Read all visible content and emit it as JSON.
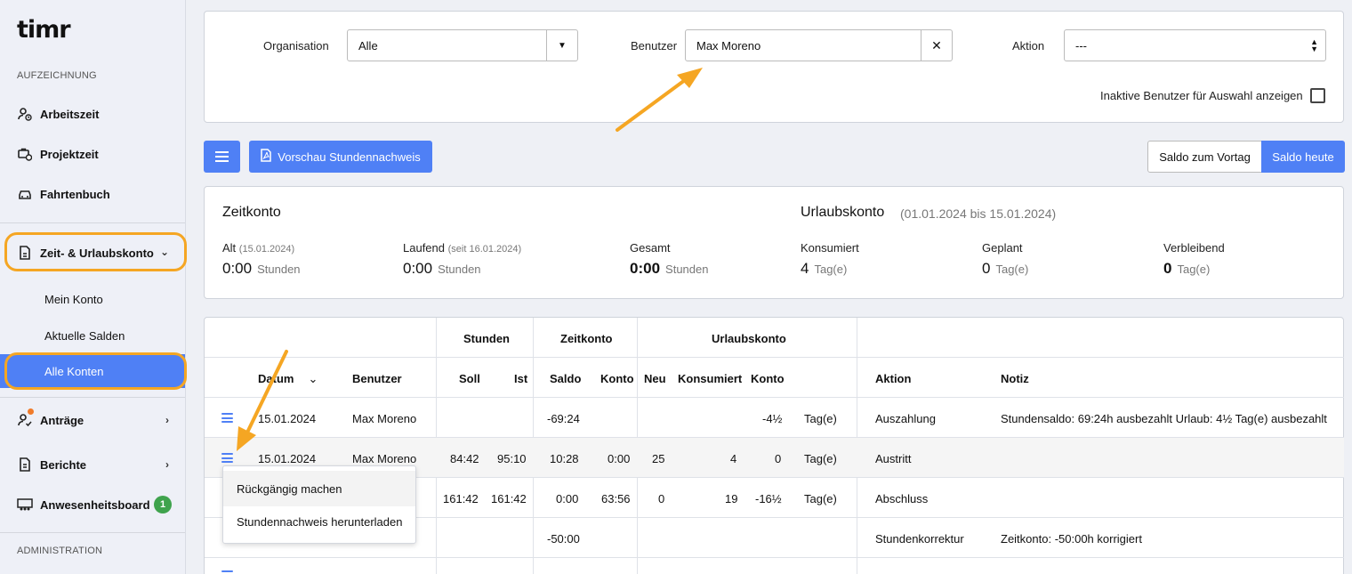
{
  "sidebar": {
    "logo": "timr",
    "section_recording": "AUFZEICHNUNG",
    "section_admin": "ADMINISTRATION",
    "items": [
      {
        "label": "Arbeitszeit",
        "icon": "user-clock-icon"
      },
      {
        "label": "Projektzeit",
        "icon": "briefcase-clock-icon"
      },
      {
        "label": "Fahrtenbuch",
        "icon": "car-icon"
      },
      {
        "label": "Zeit- & Urlaubskonto",
        "icon": "document-icon"
      },
      {
        "label": "Anträge",
        "icon": "user-check-icon"
      },
      {
        "label": "Berichte",
        "icon": "report-icon"
      },
      {
        "label": "Anwesenheitsboard",
        "icon": "team-board-icon",
        "badge": "1"
      }
    ],
    "sub_items": [
      "Mein Konto",
      "Aktuelle Salden",
      "Alle Konten"
    ]
  },
  "filters": {
    "org_label": "Organisation",
    "org_value": "Alle",
    "user_label": "Benutzer",
    "user_value": "Max Moreno",
    "action_label": "Aktion",
    "action_value": "---",
    "inactive_label": "Inaktive Benutzer für Auswahl anzeigen"
  },
  "toolbar": {
    "preview_label": "Vorschau Stundennachweis",
    "saldo_prev_label": "Saldo zum Vortag",
    "saldo_today_label": "Saldo heute"
  },
  "summary": {
    "zeitkonto_title": "Zeitkonto",
    "urlaub_title": "Urlaubskonto",
    "urlaub_range": "(01.01.2024 bis 15.01.2024)",
    "alt_label": "Alt",
    "alt_date": "(15.01.2024)",
    "alt_value": "0:00",
    "laufend_label": "Laufend",
    "laufend_date": "(seit 16.01.2024)",
    "laufend_value": "0:00",
    "gesamt_label": "Gesamt",
    "gesamt_value": "0:00",
    "hours_unit": "Stunden",
    "konsumiert_label": "Konsumiert",
    "konsumiert_value": "4",
    "geplant_label": "Geplant",
    "geplant_value": "0",
    "verbleibend_label": "Verbleibend",
    "verbleibend_value": "0",
    "days_unit": "Tag(e)"
  },
  "table": {
    "group_headers": {
      "stunden": "Stunden",
      "zeitkonto": "Zeitkonto",
      "urlaubskonto": "Urlaubskonto"
    },
    "headers": {
      "datum": "Datum",
      "benutzer": "Benutzer",
      "soll": "Soll",
      "ist": "Ist",
      "saldo": "Saldo",
      "konto": "Konto",
      "neu": "Neu",
      "konsumiert": "Konsumiert",
      "ukonto": "Konto",
      "aktion": "Aktion",
      "notiz": "Notiz"
    },
    "rows": [
      {
        "datum": "15.01.2024",
        "benutzer": "Max Moreno",
        "soll": "",
        "ist": "",
        "saldo": "-69:24",
        "konto": "",
        "neu": "",
        "konsumiert": "",
        "ukonto": "-4½",
        "unit": "Tag(e)",
        "aktion": "Auszahlung",
        "notiz": "Stundensaldo: 69:24h ausbezahlt Urlaub: 4½ Tag(e) ausbezahlt"
      },
      {
        "datum": "15.01.2024",
        "benutzer": "Max Moreno",
        "soll": "84:42",
        "ist": "95:10",
        "saldo": "10:28",
        "konto": "0:00",
        "neu": "25",
        "konsumiert": "4",
        "ukonto": "0",
        "unit": "Tag(e)",
        "aktion": "Austritt",
        "notiz": ""
      },
      {
        "datum": "",
        "benutzer": "",
        "soll": "161:42",
        "ist": "161:42",
        "saldo": "0:00",
        "konto": "63:56",
        "neu": "0",
        "konsumiert": "19",
        "ukonto": "-16½",
        "unit": "Tag(e)",
        "aktion": "Abschluss",
        "notiz": ""
      },
      {
        "datum": "",
        "benutzer": "",
        "soll": "",
        "ist": "",
        "saldo": "-50:00",
        "konto": "",
        "neu": "",
        "konsumiert": "",
        "ukonto": "",
        "unit": "",
        "aktion": "Stundenkorrektur",
        "notiz": "Zeitkonto: -50:00h korrigiert"
      }
    ]
  },
  "context_menu": {
    "undo_label": "Rückgängig machen",
    "download_label": "Stundennachweis herunterladen"
  },
  "colors": {
    "accent": "#4f80f5",
    "highlight": "#f5a623",
    "badge": "#3fa34d"
  }
}
